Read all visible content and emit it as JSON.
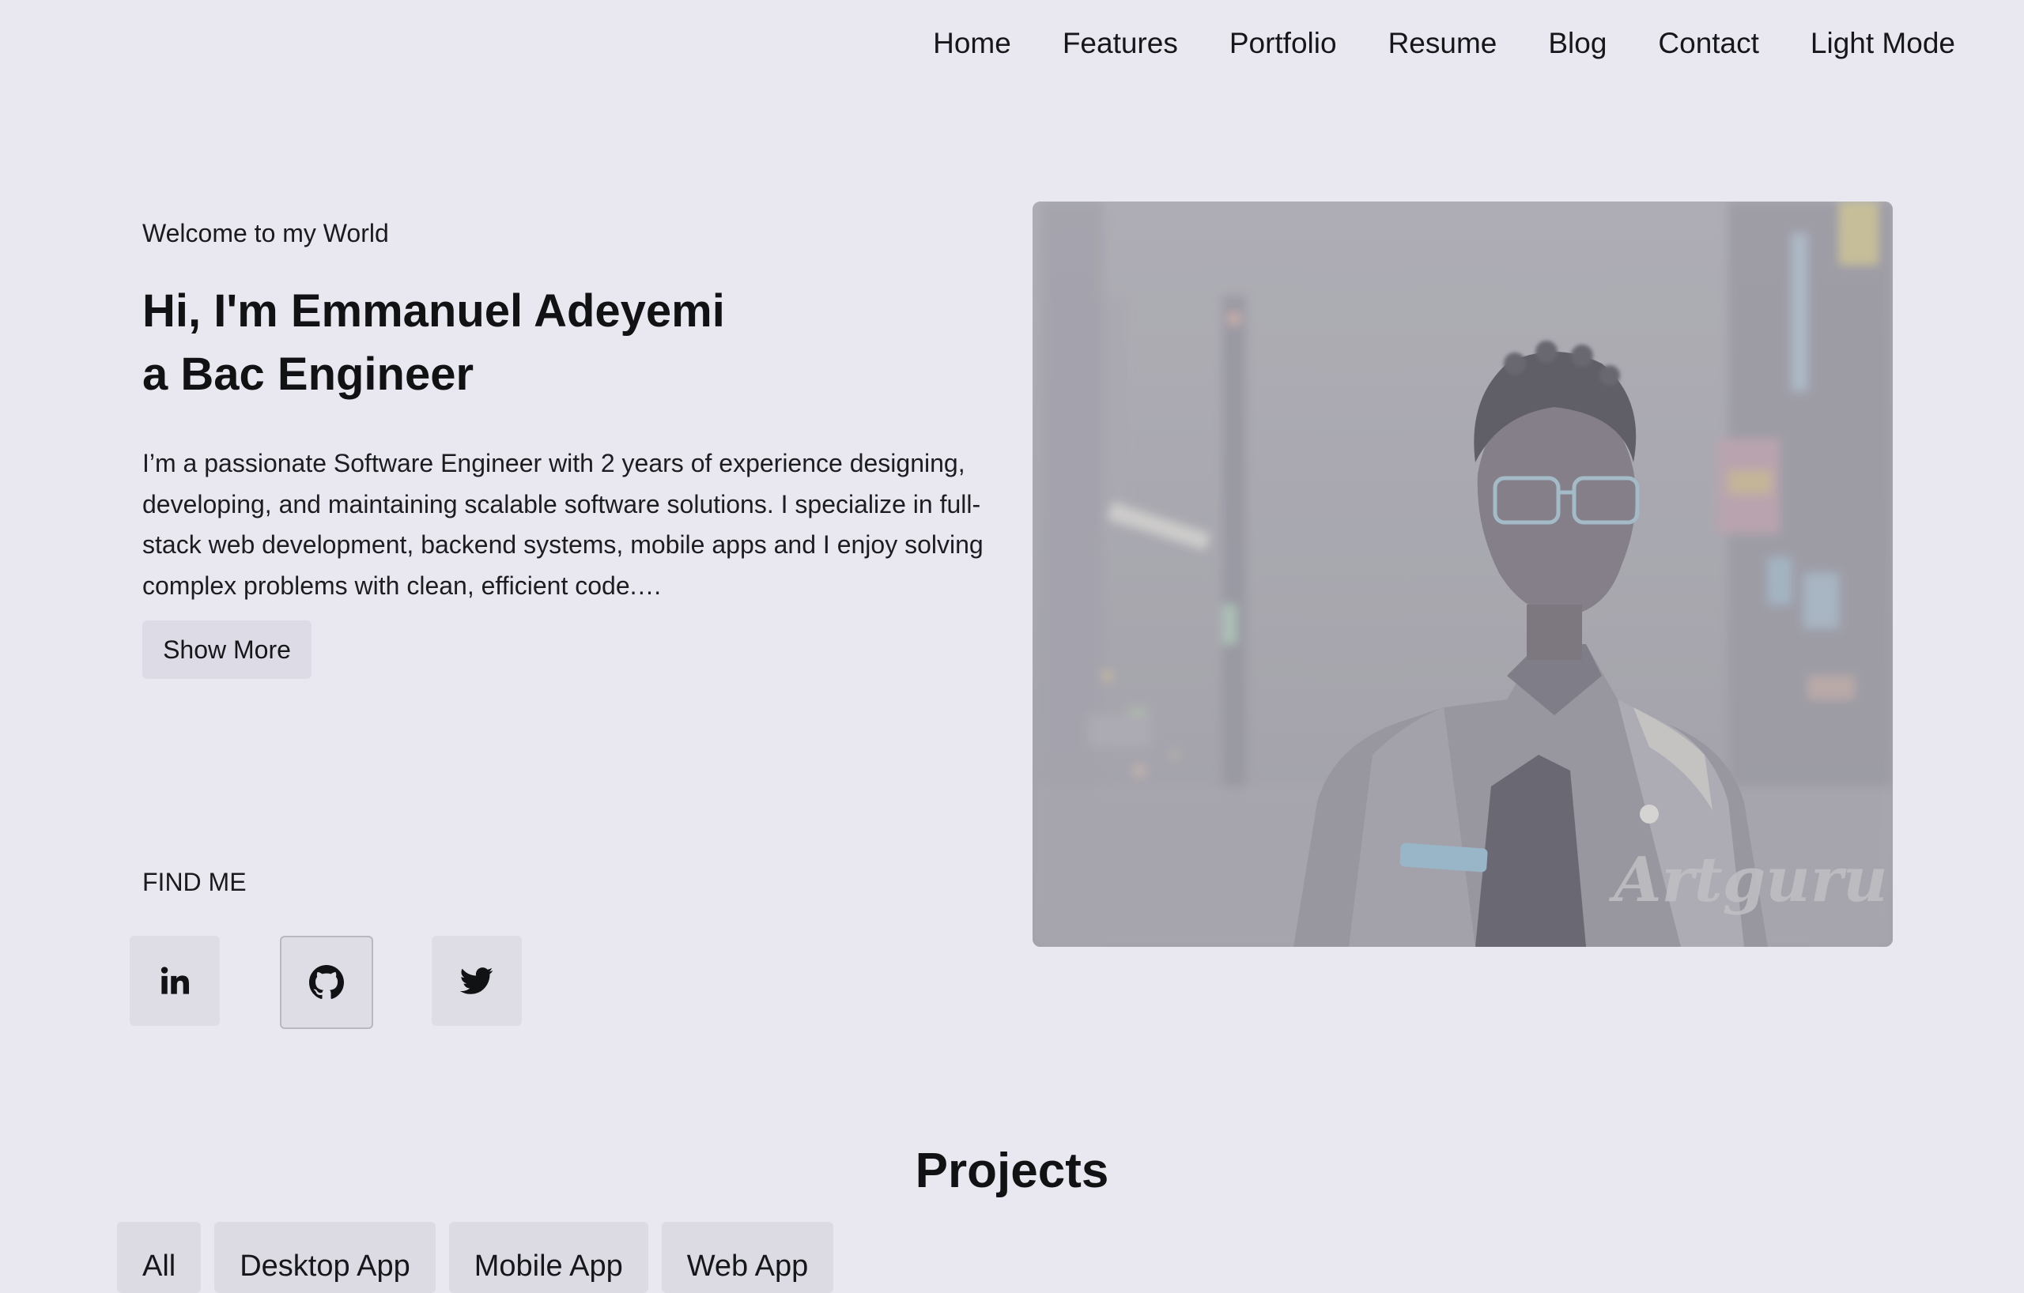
{
  "nav": {
    "items": [
      "Home",
      "Features",
      "Portfolio",
      "Resume",
      "Blog",
      "Contact",
      "Light Mode"
    ]
  },
  "hero": {
    "welcome": "Welcome to my World",
    "headline_line1": "Hi, I'm Emmanuel Adeyemi",
    "headline_line2": "a Bac Engineer",
    "bio": "I’m a passionate Software Engineer with 2 years of experience designing, developing, and maintaining scalable software solutions. I specialize in full-stack web development, backend systems, mobile apps and I enjoy solving complex problems with clean, efficient code.…",
    "show_more_label": "Show More",
    "find_me_label": "FIND ME",
    "socials": [
      {
        "name": "linkedin",
        "icon": "linkedin-icon"
      },
      {
        "name": "github",
        "icon": "github-icon"
      },
      {
        "name": "twitter",
        "icon": "twitter-icon"
      }
    ],
    "image_watermark": "Artguru"
  },
  "projects": {
    "title": "Projects",
    "filters": [
      "All",
      "Desktop App",
      "Mobile App",
      "Web App"
    ]
  },
  "colors": {
    "background": "#e9e8f0",
    "button_bg": "#dddce6",
    "text": "#111214"
  }
}
